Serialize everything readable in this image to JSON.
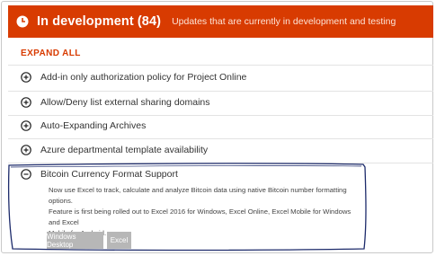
{
  "header": {
    "icon": "clock-icon",
    "title": "In development (84)",
    "subtitle": "Updates that are currently in development and testing",
    "color": "#d83b01"
  },
  "expand_all_label": "EXPAND ALL",
  "items": [
    {
      "label": "Add-in only authorization policy for Project Online",
      "state": "collapsed"
    },
    {
      "label": "Allow/Deny list external sharing domains",
      "state": "collapsed"
    },
    {
      "label": "Auto-Expanding Archives",
      "state": "collapsed"
    },
    {
      "label": "Azure departmental template availability",
      "state": "collapsed"
    }
  ],
  "expanded_item": {
    "label": "Bitcoin Currency Format Support",
    "state": "expanded",
    "description_lines": [
      "Now use Excel to track, calculate and analyze Bitcoin data using native Bitcoin number formatting options.",
      "Feature is first being rolled out to Excel 2016 for Windows, Excel Online, Excel Mobile for Windows and Excel",
      "Mobile for Android."
    ],
    "tags": [
      "Windows Desktop",
      "Excel"
    ]
  }
}
